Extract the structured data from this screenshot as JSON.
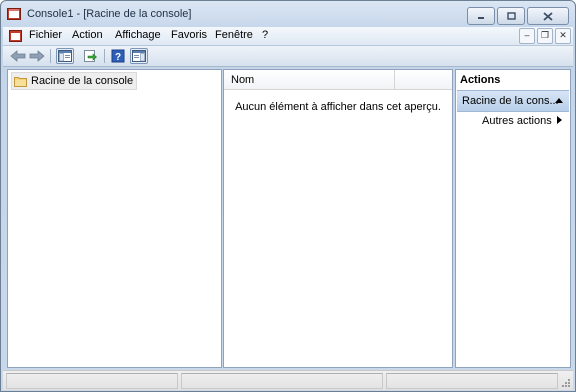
{
  "window": {
    "title": "Console1 - [Racine de la console]"
  },
  "caption_buttons": {
    "minimize": "minimize",
    "restore": "restore",
    "close": "close"
  },
  "menu": {
    "items": [
      {
        "label": "Fichier"
      },
      {
        "label": "Action"
      },
      {
        "label": "Affichage"
      },
      {
        "label": "Favoris"
      },
      {
        "label": "Fenêtre"
      },
      {
        "label": "?"
      }
    ]
  },
  "mdi_buttons": [
    "minimize-doc",
    "restore-doc",
    "close-doc"
  ],
  "toolbar": {
    "buttons": [
      "back-arrow-icon",
      "forward-arrow-icon",
      "show-hide-tree-icon",
      "export-list-icon",
      "help-icon",
      "show-hide-action-pane-icon"
    ]
  },
  "tree": {
    "root_label": "Racine de la console"
  },
  "list": {
    "column_name": "Nom",
    "empty_message": "Aucun élément à afficher dans cet aperçu."
  },
  "actions": {
    "title": "Actions",
    "section_label": "Racine de la cons...",
    "item_label": "Autres actions"
  },
  "colors": {
    "accent": "#b8cfea",
    "frame": "#c4d5ea"
  }
}
